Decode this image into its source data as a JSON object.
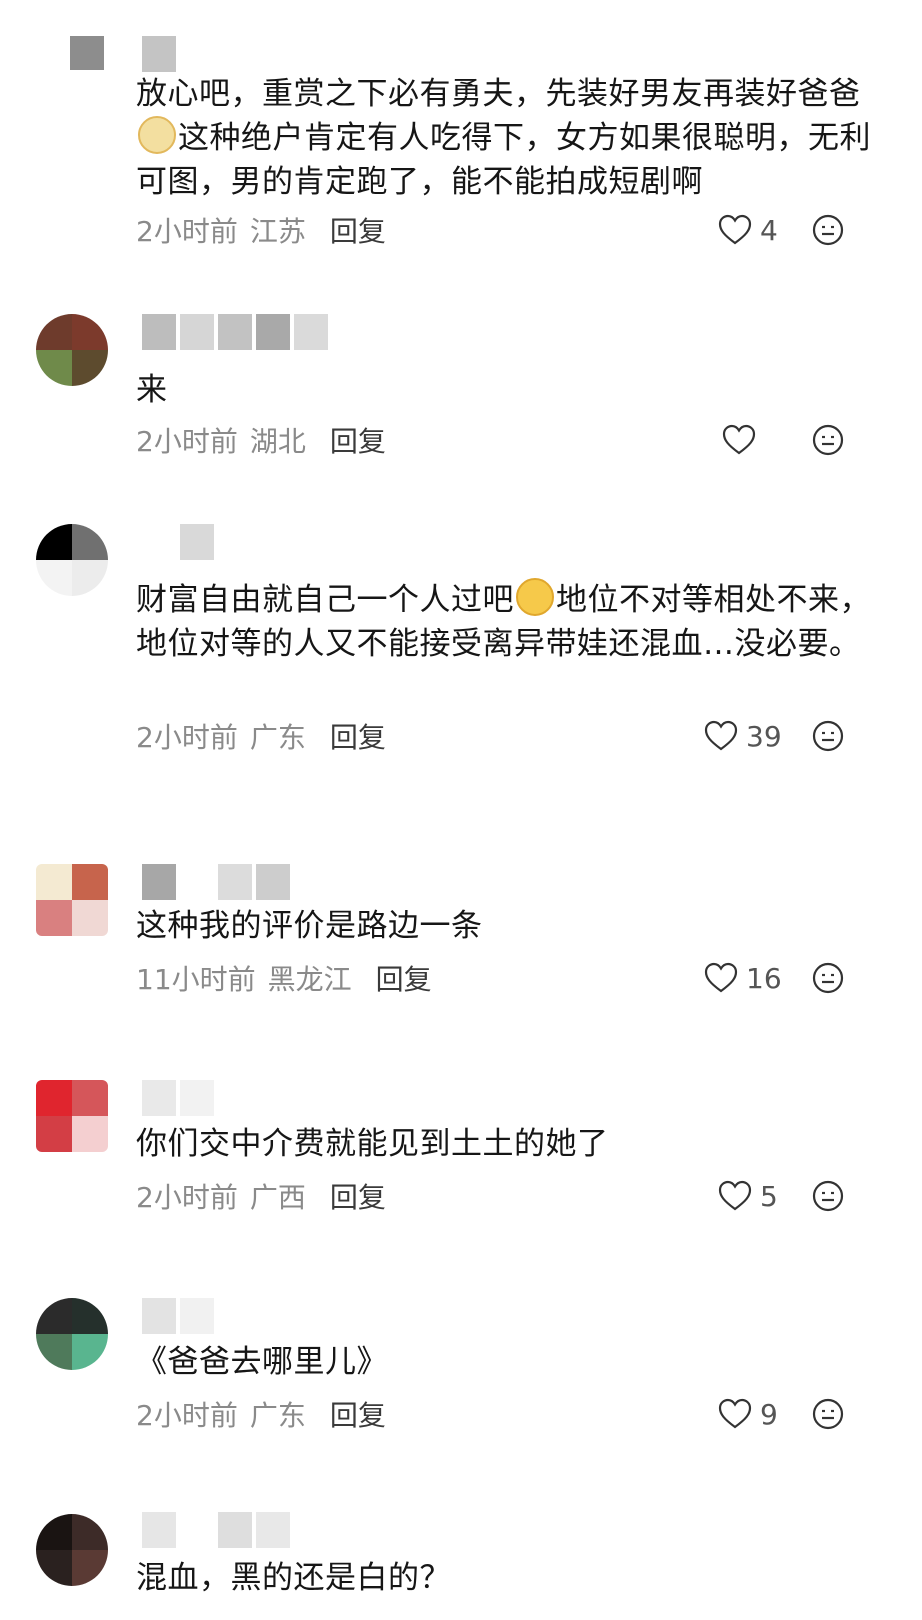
{
  "comments": [
    {
      "text": "放心吧，重赏之下必有勇夫，先装好男友再装好爸爸🐹这种绝户肯定有人吃得下，女方如果很聪明，无利可图，男的肯定跑了，能不能拍成短剧啊",
      "text_parts": [
        "放心吧，重赏之下必有勇夫，先装好男友再装好爸爸",
        "这种绝户肯定有人吃得下，女方如果很聪明，无利可图，男的肯定跑了，能不能拍成短剧啊"
      ],
      "time": "2小时前",
      "location": "江苏",
      "reply": "回复",
      "likes": "4"
    },
    {
      "text": "来",
      "time": "2小时前",
      "location": "湖北",
      "reply": "回复",
      "likes": ""
    },
    {
      "text": "财富自由就自己一个人过吧😂地位不对等相处不来，地位对等的人又不能接受离异带娃还混血…没必要。",
      "text_parts": [
        "财富自由就自己一个人过吧",
        "地位不对等相处不来，地位对等的人又不能接受离异带娃还混血…没必要。"
      ],
      "time": "2小时前",
      "location": "广东",
      "reply": "回复",
      "likes": "39"
    },
    {
      "text": "这种我的评价是路边一条",
      "time": "11小时前",
      "location": "黑龙江",
      "reply": "回复",
      "likes": "16"
    },
    {
      "text": "你们交中介费就能见到土土的她了",
      "time": "2小时前",
      "location": "广西",
      "reply": "回复",
      "likes": "5"
    },
    {
      "text": "《爸爸去哪里儿》",
      "time": "2小时前",
      "location": "广东",
      "reply": "回复",
      "likes": "9"
    },
    {
      "text": "混血，黑的还是白的？",
      "time": "",
      "location": "",
      "reply": "",
      "likes": ""
    }
  ],
  "icons": {
    "like": "heart-outline-icon",
    "dislike": "neutral-face-icon"
  },
  "colors": {
    "text": "#161616",
    "meta": "#8a8a8a",
    "reply": "#3a3a3a"
  }
}
